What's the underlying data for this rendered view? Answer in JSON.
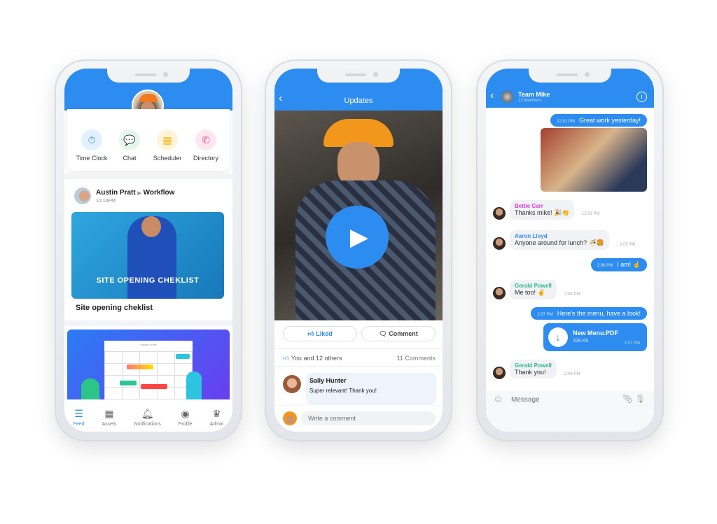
{
  "phone1": {
    "quick_actions": [
      {
        "label": "Time Clock",
        "icon": "stopwatch-icon",
        "color": "#2d8cf0"
      },
      {
        "label": "Chat",
        "icon": "chat-icon",
        "color": "#3cc36b"
      },
      {
        "label": "Scheduler",
        "icon": "calendar-icon",
        "color": "#f5b91e"
      },
      {
        "label": "Directory",
        "icon": "phone-icon",
        "color": "#f0508c"
      }
    ],
    "post": {
      "author": "Austin Pratt",
      "target": "Workflow",
      "time": "10:14PM",
      "image_caption": "SITE OPENING CHEKLIST",
      "title": "Site opening cheklist"
    },
    "second_card_caption": "Weekly shifts",
    "nav": [
      {
        "label": "Feed",
        "icon": "feed-icon",
        "active": true
      },
      {
        "label": "Assets",
        "icon": "grid-icon"
      },
      {
        "label": "Notifications",
        "icon": "bell-icon"
      },
      {
        "label": "Profile",
        "icon": "profile-icon"
      },
      {
        "label": "Admin",
        "icon": "crown-icon"
      }
    ]
  },
  "phone2": {
    "title": "Updates",
    "liked_label": "Liked",
    "comment_label": "Comment",
    "likes_text": "You and 12 others",
    "comments_count": "11 Comments",
    "comment": {
      "author": "Sally Hunter",
      "text": "Super relevant! Thank you!"
    },
    "comment_placeholder": "Write a comment"
  },
  "phone3": {
    "title": "Team Mike",
    "subtitle": "12 Members",
    "messages": [
      {
        "dir": "out",
        "time": "12:01 PM",
        "text": "Great work yesterday!"
      },
      {
        "dir": "in",
        "name": "Bettie Carr",
        "name_color": "#d63ce0",
        "text": "Thanks mike! 🎉👏",
        "time": "12:03 PM"
      },
      {
        "dir": "in",
        "name": "Aaron Lloyd",
        "name_color": "#3a8ee8",
        "text": "Anyone around for lunch? 🍜🍔",
        "time": "2:05 PM"
      },
      {
        "dir": "out",
        "time": "2:06 PM",
        "text": "I am! ☝"
      },
      {
        "dir": "in",
        "name": "Gerald Powell",
        "name_color": "#2fb98a",
        "text": "Me too! ✌",
        "time": "2:06 PM"
      },
      {
        "dir": "out",
        "time": "2:07 PM",
        "text": "Here's the menu, have a look!"
      },
      {
        "dir": "in",
        "name": "Gerald Powell",
        "name_color": "#2fb98a",
        "text": "Thank you!",
        "time": "2:06 PM"
      }
    ],
    "file": {
      "name": "New Menu.PDF",
      "size": "328 Kb",
      "time": "2:07 PM"
    },
    "message_placeholder": "Message"
  },
  "colors": {
    "accent": "#2d8cf0"
  }
}
